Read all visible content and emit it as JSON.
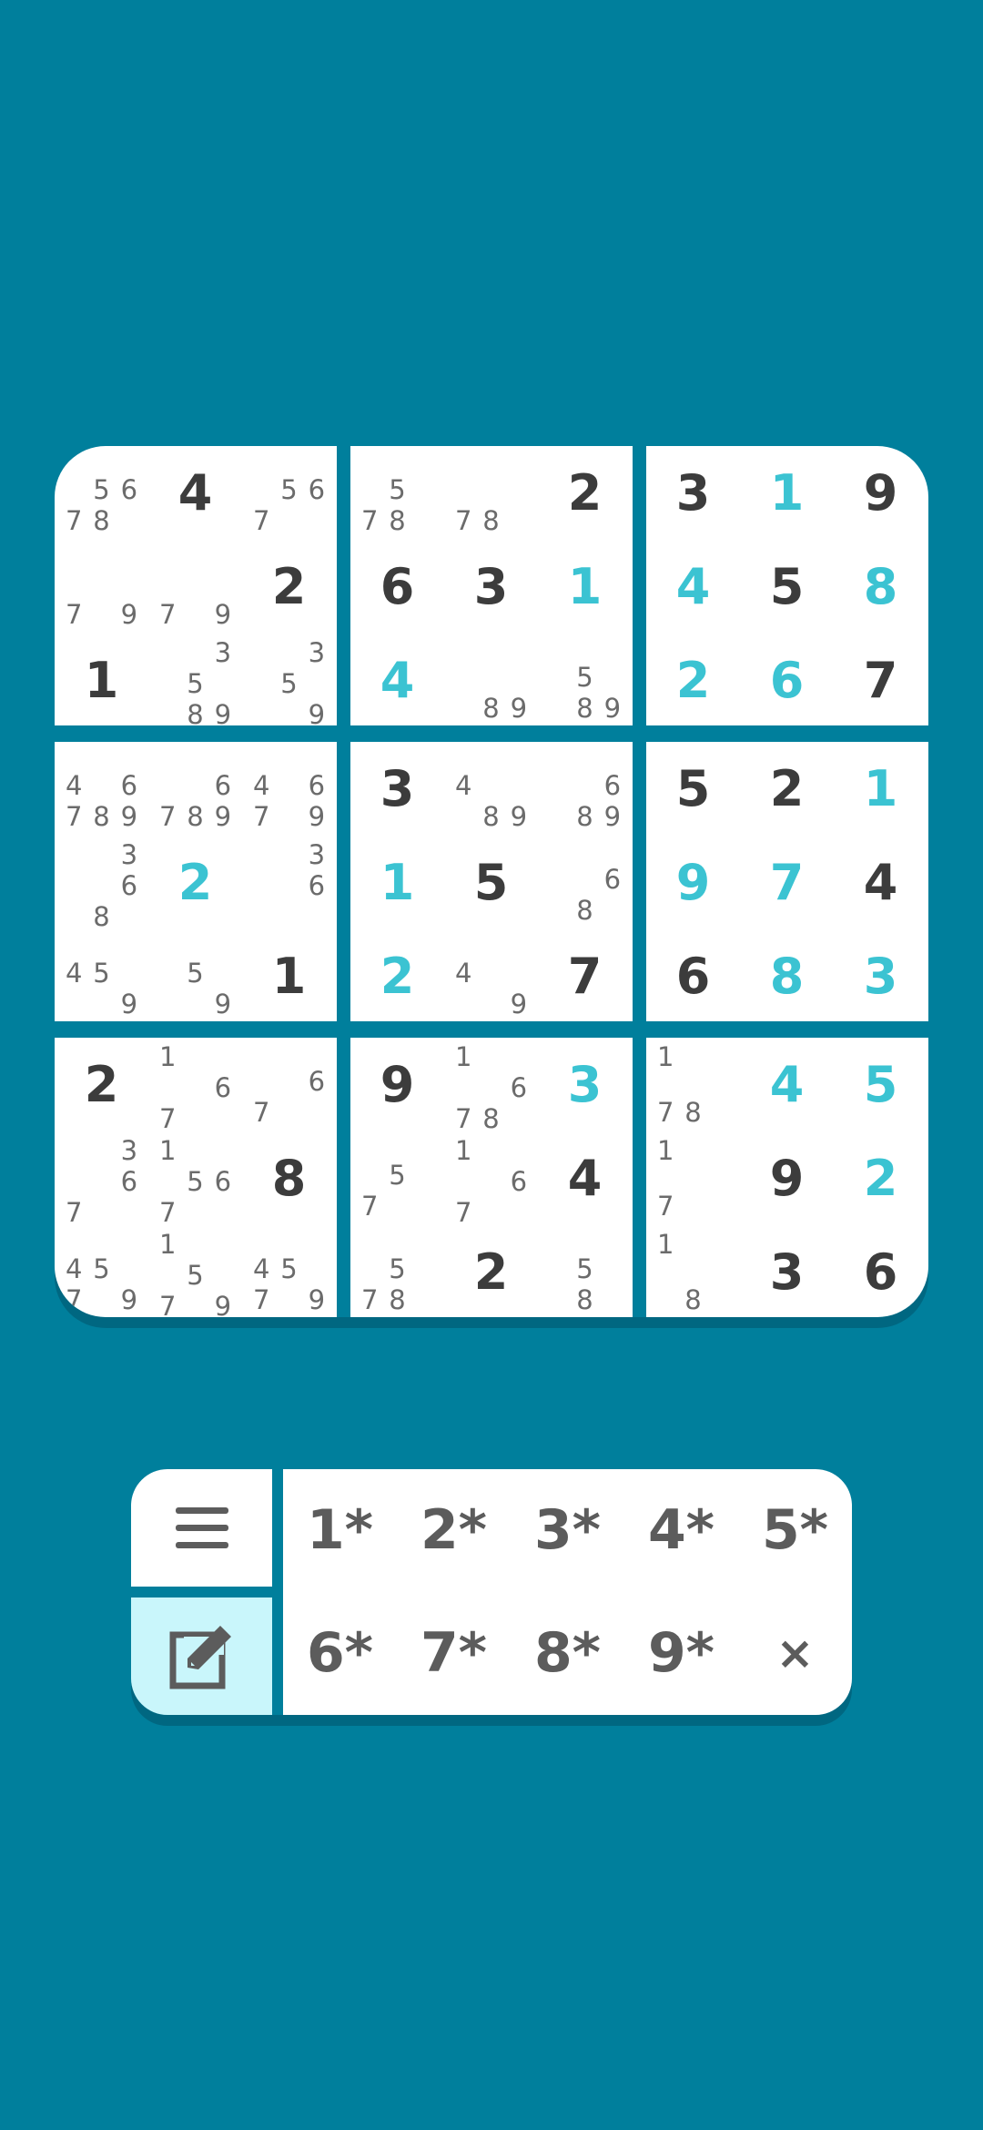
{
  "colors": {
    "background": "#007f9c",
    "cell": "#ffffff",
    "given_digit": "#3c3c3c",
    "entered_digit": "#3bc3d2",
    "note_digit": "#6b6b6b",
    "notes_toggle_active": "#c9f6fb"
  },
  "grid": [
    [
      {
        "n": "5,6,7,8"
      },
      {
        "v": "4",
        "t": "given"
      },
      {
        "n": "5,6,7"
      },
      {
        "n": "5,7,8"
      },
      {
        "n": "7,8"
      },
      {
        "v": "2",
        "t": "given"
      },
      {
        "v": "3",
        "t": "given"
      },
      {
        "v": "1",
        "t": "entry"
      },
      {
        "v": "9",
        "t": "given"
      }
    ],
    [
      {
        "n": "7,9"
      },
      {
        "n": "7,9"
      },
      {
        "v": "2",
        "t": "given"
      },
      {
        "v": "6",
        "t": "given"
      },
      {
        "v": "3",
        "t": "given"
      },
      {
        "v": "1",
        "t": "entry"
      },
      {
        "v": "4",
        "t": "entry"
      },
      {
        "v": "5",
        "t": "given"
      },
      {
        "v": "8",
        "t": "entry"
      }
    ],
    [
      {
        "v": "1",
        "t": "given"
      },
      {
        "n": "3,5,8,9"
      },
      {
        "n": "3,5,9"
      },
      {
        "v": "4",
        "t": "entry"
      },
      {
        "n": "8,9"
      },
      {
        "n": "5,8,9"
      },
      {
        "v": "2",
        "t": "entry"
      },
      {
        "v": "6",
        "t": "entry"
      },
      {
        "v": "7",
        "t": "given"
      }
    ],
    [
      {
        "n": "4,6,7,8,9"
      },
      {
        "n": "6,7,8,9"
      },
      {
        "n": "4,6,7,9"
      },
      {
        "v": "3",
        "t": "given"
      },
      {
        "n": "4,8,9"
      },
      {
        "n": "6,8,9"
      },
      {
        "v": "5",
        "t": "given"
      },
      {
        "v": "2",
        "t": "given"
      },
      {
        "v": "1",
        "t": "entry"
      }
    ],
    [
      {
        "n": "3,6,8"
      },
      {
        "v": "2",
        "t": "entry"
      },
      {
        "n": "3,6"
      },
      {
        "v": "1",
        "t": "entry"
      },
      {
        "v": "5",
        "t": "given"
      },
      {
        "n": "6,8"
      },
      {
        "v": "9",
        "t": "entry"
      },
      {
        "v": "7",
        "t": "entry"
      },
      {
        "v": "4",
        "t": "given"
      }
    ],
    [
      {
        "n": "4,5,9"
      },
      {
        "n": "5,9"
      },
      {
        "v": "1",
        "t": "given"
      },
      {
        "v": "2",
        "t": "entry"
      },
      {
        "n": "4,9"
      },
      {
        "v": "7",
        "t": "given"
      },
      {
        "v": "6",
        "t": "given"
      },
      {
        "v": "8",
        "t": "entry"
      },
      {
        "v": "3",
        "t": "entry"
      }
    ],
    [
      {
        "v": "2",
        "t": "given"
      },
      {
        "n": "1,6,7"
      },
      {
        "n": "6,7"
      },
      {
        "v": "9",
        "t": "given"
      },
      {
        "n": "1,6,7,8"
      },
      {
        "v": "3",
        "t": "entry"
      },
      {
        "n": "1,7,8"
      },
      {
        "v": "4",
        "t": "entry"
      },
      {
        "v": "5",
        "t": "entry"
      }
    ],
    [
      {
        "n": "3,6,7"
      },
      {
        "n": "1,5,6,7"
      },
      {
        "v": "8",
        "t": "given"
      },
      {
        "n": "5,7"
      },
      {
        "n": "1,6,7"
      },
      {
        "v": "4",
        "t": "given"
      },
      {
        "n": "1,7"
      },
      {
        "v": "9",
        "t": "given"
      },
      {
        "v": "2",
        "t": "entry"
      }
    ],
    [
      {
        "n": "4,5,7,9"
      },
      {
        "n": "1,5,7,9"
      },
      {
        "n": "4,5,7,9"
      },
      {
        "n": "5,7,8"
      },
      {
        "v": "2",
        "t": "given"
      },
      {
        "n": "5,8"
      },
      {
        "n": "1,8"
      },
      {
        "v": "3",
        "t": "given"
      },
      {
        "v": "6",
        "t": "given"
      }
    ]
  ],
  "numpad": {
    "keys": [
      "1*",
      "2*",
      "3*",
      "4*",
      "5*",
      "6*",
      "7*",
      "8*",
      "9*",
      "×"
    ]
  },
  "icons": {
    "menu": "hamburger-menu-icon",
    "notes": "edit-pencil-icon"
  }
}
